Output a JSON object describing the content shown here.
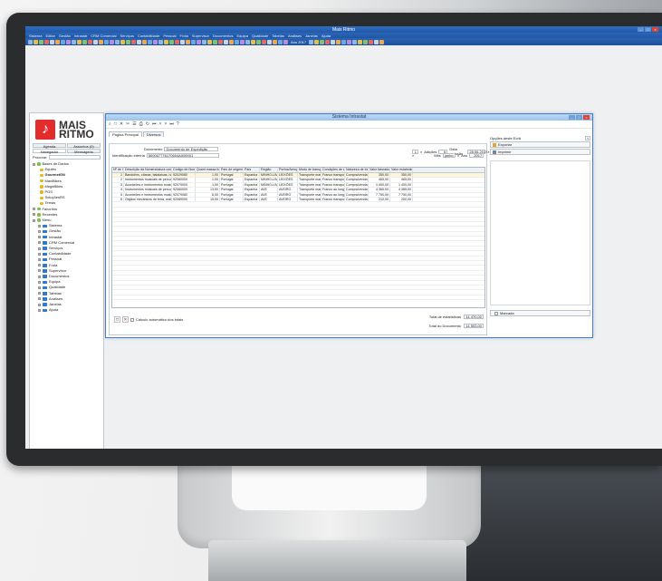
{
  "app": {
    "title": "Mais Ritmo",
    "menu": [
      "Sistema",
      "Editar",
      "Gestão",
      "Intrastat",
      "CRM Comercial",
      "Serviços",
      "Contabilidade",
      "Pessoal",
      "Frota",
      "Supervisor",
      "Documentos",
      "Equipa",
      "Qualidade",
      "Tabelas",
      "Análises",
      "Janelas",
      "Ajuda"
    ],
    "year_label": "Ano 2017"
  },
  "sidebar": {
    "logo_line1": "MAIS",
    "logo_line2": "RITMO",
    "tabs": [
      "Agenda",
      "Assuntos (0)",
      "Navegador",
      "Mensagens"
    ],
    "search_label": "Procurar:",
    "tree": [
      {
        "label": "Bases de Dados",
        "type": "root"
      },
      {
        "label": "Equifro",
        "type": "db"
      },
      {
        "label": "GourmetSN",
        "type": "db",
        "bold": true
      },
      {
        "label": "MaxiBikes",
        "type": "db"
      },
      {
        "label": "MegaBikes",
        "type": "db"
      },
      {
        "label": "POS",
        "type": "db"
      },
      {
        "label": "SoluçõesRS",
        "type": "db"
      },
      {
        "label": "Temas",
        "type": "db"
      },
      {
        "label": "Favoritos",
        "type": "root"
      },
      {
        "label": "Recentes",
        "type": "root"
      },
      {
        "label": "Menu",
        "type": "root"
      },
      {
        "label": "Sistema",
        "type": "folder"
      },
      {
        "label": "Gestão",
        "type": "folder"
      },
      {
        "label": "Intrastat",
        "type": "folder"
      },
      {
        "label": "CRM Comercial",
        "type": "folder"
      },
      {
        "label": "Serviços",
        "type": "folder"
      },
      {
        "label": "Contabilidade",
        "type": "folder"
      },
      {
        "label": "Pessoal",
        "type": "folder"
      },
      {
        "label": "Frota",
        "type": "folder"
      },
      {
        "label": "Supervisor",
        "type": "folder"
      },
      {
        "label": "Documentos",
        "type": "folder"
      },
      {
        "label": "Equipa",
        "type": "folder"
      },
      {
        "label": "Qualidade",
        "type": "folder"
      },
      {
        "label": "Tabelas",
        "type": "folder"
      },
      {
        "label": "Análises",
        "type": "folder"
      },
      {
        "label": "Janelas",
        "type": "folder"
      },
      {
        "label": "Ajuda",
        "type": "folder"
      }
    ]
  },
  "window": {
    "title": "Sistema Intrastat",
    "tabs": [
      "Página Principal",
      "Diversos"
    ],
    "documento_label": "Documento",
    "documento_value": "Documento de Expedição",
    "ident_label": "Identificação interna",
    "ident_value": "500007776170604A000001",
    "page_value": "1",
    "adicoes_label": "Adições",
    "adicoes_value": "6",
    "data_label": "Data emissão",
    "data_value": "28.06.2017",
    "mes_label": "Mês",
    "mes_value": "junho",
    "ano_label": "Ano",
    "ano_value": "2017",
    "columns": [
      "Nº de Ordem",
      "Descrição da Nomenclatura combinada",
      "Código de Nomenclatura",
      "Quant.massa líquida",
      "País de origem",
      "País",
      "Região",
      "Portos/Aeroportos",
      "Modo de transporte",
      "Condições de entrega",
      "Natureza de transação",
      "Valor faturado c/IVA",
      "Valor estatístico"
    ],
    "rows": [
      [
        "1",
        "Bandolins, cítaras, balalaicas, harpas e ou",
        "92029080",
        "1,00",
        "Portugal",
        "Espanha",
        "MINHO-LIMA",
        "LEIXÕES",
        "Transporte marítimo",
        "Franco transportador",
        "Compra/venda firme",
        "350,00",
        "350,00"
      ],
      [
        "2",
        "Instrumentos musicais de percussão, por ex",
        "92060000",
        "1,00",
        "Portugal",
        "Espanha",
        "MINHO-LIMA",
        "LEIXÕES",
        "Transporte marítimo",
        "Franco transportador",
        "Compra/venda firme",
        "465,00",
        "465,00"
      ],
      [
        "3",
        "Acordeões e instrumentos musicais sem te",
        "92079000",
        "1,00",
        "Portugal",
        "Espanha",
        "MINHO-LIMA",
        "LEIXÕES",
        "Transporte marítimo",
        "Franco transportador",
        "Compra/venda firme",
        "1 400,00",
        "1 400,00"
      ],
      [
        "4",
        "Instrumentos musicais de percussão, por ex",
        "92060000",
        "13,00",
        "Portugal",
        "Espanha",
        "AVE",
        "AVEIRO",
        "Transporte marítimo",
        "Franco ao longo do navio",
        "Compra/venda firme",
        "4 365,00",
        "4 365,00"
      ],
      [
        "5",
        "Acordeões e instrumentos musicais sem te",
        "92079080",
        "6,00",
        "Portugal",
        "Espanha",
        "AVE",
        "AVEIRO",
        "Transporte marítimo",
        "Franco ao longo do navio",
        "Compra/venda firme",
        "7 750,00",
        "7 750,00"
      ],
      [
        "6",
        "Órgãos mecânicos de feira, realejos, pássa",
        "92089000",
        "15,00",
        "Portugal",
        "Espanha",
        "AVE",
        "AVEIRO",
        "Transporte marítimo",
        "Franco transportador",
        "Compra/venda firme",
        "210,00",
        "200,00"
      ]
    ],
    "auto_calc_label": "Cálculo automático dos totais",
    "total_estat_label": "Total de estatísticas",
    "total_estat_value": "14 470,00",
    "total_doc_label": "Total do Documento",
    "total_doc_value": "14 553,00",
    "options_label": "Opções deste Ecrã",
    "exportar_label": "Exportar",
    "imprimir_label": "Imprimir",
    "marcada_label": "Marcada"
  }
}
